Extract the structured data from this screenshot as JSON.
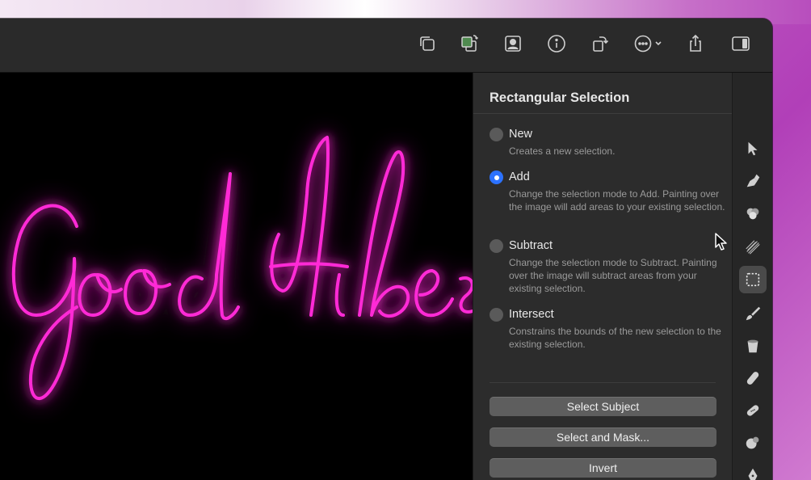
{
  "toolbar": {
    "buttons": [
      {
        "icon": "overlapping-squares-icon"
      },
      {
        "icon": "color-swap-icon"
      },
      {
        "icon": "portrait-icon"
      },
      {
        "icon": "info-icon"
      },
      {
        "icon": "rotate-icon"
      },
      {
        "icon": "more-menu-icon"
      },
      {
        "icon": "share-icon"
      },
      {
        "icon": "sidebar-toggle-icon"
      }
    ]
  },
  "panel": {
    "title": "Rectangular Selection",
    "options": [
      {
        "label": "New",
        "description": "Creates a new selection.",
        "selected": false
      },
      {
        "label": "Add",
        "description": "Change the selection mode to Add. Painting over the image will add areas to your existing selection.",
        "selected": true
      },
      {
        "label": "Subtract",
        "description": "Change the selection mode to Subtract. Painting over the image will subtract areas from your existing selection.",
        "selected": false
      },
      {
        "label": "Intersect",
        "description": "Constrains the bounds of the new selection to the existing selection.",
        "selected": false
      }
    ],
    "buttons": {
      "select_subject": "Select Subject",
      "select_and_mask": "Select and Mask...",
      "invert": "Invert"
    }
  },
  "tools": [
    {
      "icon": "arrow-pointer-icon",
      "active": false
    },
    {
      "icon": "pen-nib-icon",
      "active": false
    },
    {
      "icon": "color-circles-icon",
      "active": false
    },
    {
      "icon": "sketch-lines-icon",
      "active": false
    },
    {
      "icon": "rectangular-selection-icon",
      "active": true
    },
    {
      "icon": "brush-icon",
      "active": false
    },
    {
      "icon": "paint-bucket-icon",
      "active": false
    },
    {
      "icon": "eraser-icon",
      "active": false
    },
    {
      "icon": "bandage-icon",
      "active": false
    },
    {
      "icon": "clone-stamp-icon",
      "active": false
    },
    {
      "icon": "vector-pen-icon",
      "active": false
    }
  ],
  "canvas": {
    "neon_color": "#ff2bd6",
    "glow_color": "#c300b8"
  },
  "colors": {
    "accent": "#2c72ff",
    "panel_bg": "#2c2c2c"
  }
}
